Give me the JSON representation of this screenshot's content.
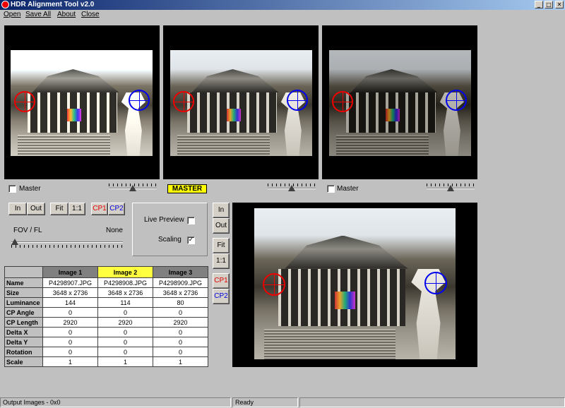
{
  "window": {
    "title": "HDR Alignment Tool  v2.0",
    "minimize": "_",
    "restore": "□",
    "close": "✕"
  },
  "menu": [
    "Open",
    "Save All",
    "About",
    "Close"
  ],
  "panels": [
    {
      "master_label": "Master",
      "master_checked": false
    },
    {
      "master_badge": "MASTER"
    },
    {
      "master_label": "Master",
      "master_checked": false
    }
  ],
  "controls": {
    "in": "In",
    "out": "Out",
    "fit": "Fit",
    "one_to_one": "1:1",
    "cp1": "CP1",
    "cp2": "CP2",
    "fov_label": "FOV / FL",
    "fov_value": "None",
    "live_preview": "Live Preview",
    "live_preview_checked": false,
    "scaling": "Scaling",
    "scaling_checked": true,
    "cp1_color": "#e00000",
    "cp2_color": "#0000e0"
  },
  "right_controls": {
    "in": "In",
    "out": "Out",
    "fit": "Fit",
    "one_to_one": "1:1",
    "cp1": "CP1",
    "cp2": "CP2"
  },
  "table": {
    "columns": [
      "Image 1",
      "Image 2",
      "Image 3"
    ],
    "selected_column": 1,
    "rows": [
      {
        "label": "Name",
        "values": [
          "P4298907.JPG",
          "P4298908.JPG",
          "P4298909.JPG"
        ]
      },
      {
        "label": "Size",
        "values": [
          "3648 x 2736",
          "3648 x 2736",
          "3648 x 2736"
        ]
      },
      {
        "label": "Luminance",
        "values": [
          "144",
          "114",
          "80"
        ]
      },
      {
        "label": "CP Angle",
        "values": [
          "0",
          "0",
          "0"
        ]
      },
      {
        "label": "CP Length",
        "values": [
          "2920",
          "2920",
          "2920"
        ]
      },
      {
        "label": "Delta X",
        "values": [
          "0",
          "0",
          "0"
        ]
      },
      {
        "label": "Delta Y",
        "values": [
          "0",
          "0",
          "0"
        ]
      },
      {
        "label": "Rotation",
        "values": [
          "0",
          "0",
          "0"
        ]
      },
      {
        "label": "Scale",
        "values": [
          "1",
          "1",
          "1"
        ]
      }
    ]
  },
  "status": {
    "output": "Output Images - 0x0",
    "state": "Ready",
    "extra": ""
  }
}
